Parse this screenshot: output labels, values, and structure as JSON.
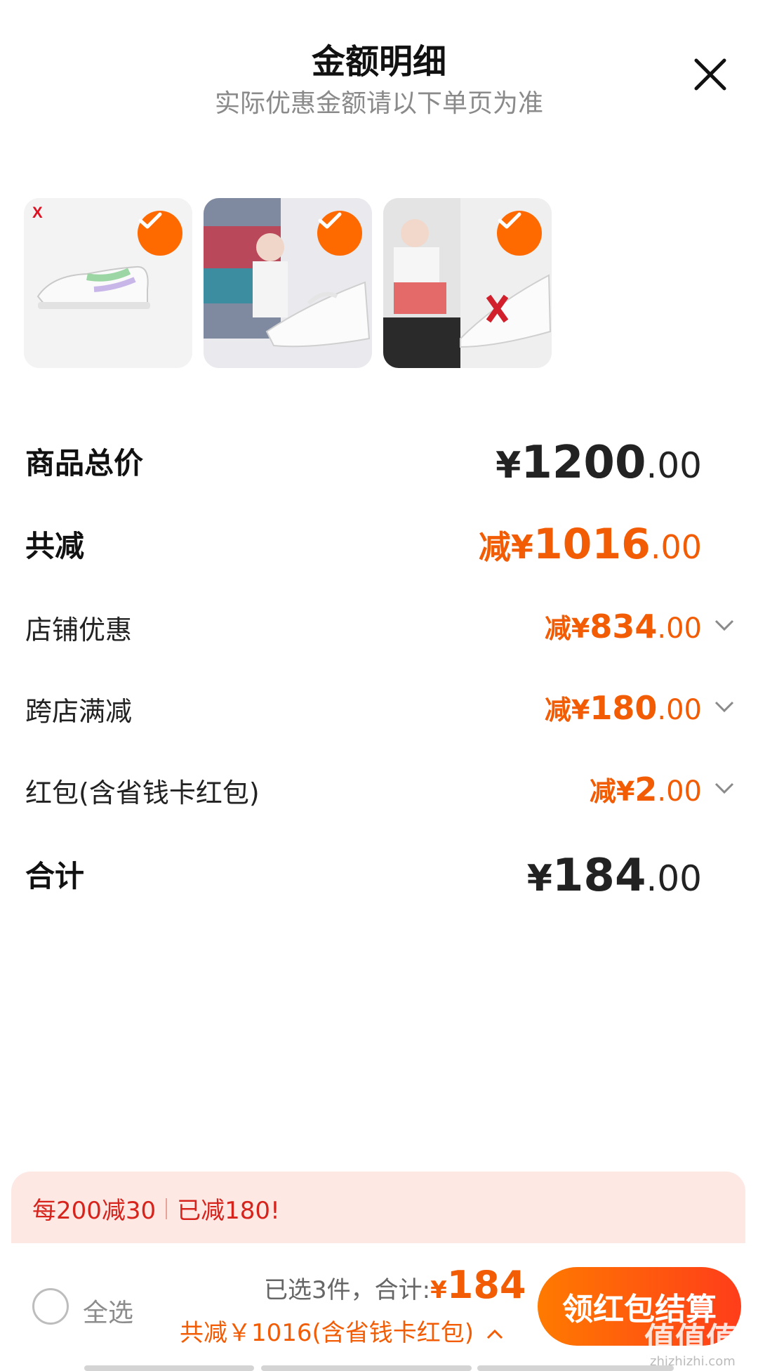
{
  "header": {
    "title": "金额明细",
    "subtitle": "实际优惠金额请以下单页为准"
  },
  "products": [
    {
      "name": "product-thumbnail-1",
      "checked": true
    },
    {
      "name": "product-thumbnail-2",
      "checked": true
    },
    {
      "name": "product-thumbnail-3",
      "checked": true
    }
  ],
  "breakdown": {
    "total": {
      "label": "商品总价",
      "symbol": "¥",
      "int": "1200",
      "dec": ".00"
    },
    "discount": {
      "label": "共减",
      "prefix": "减",
      "symbol": "¥",
      "int": "1016",
      "dec": ".00"
    },
    "shop": {
      "label": "店铺优惠",
      "prefix": "减",
      "symbol": "¥",
      "int": "834",
      "dec": ".00"
    },
    "cross": {
      "label": "跨店满减",
      "prefix": "减",
      "symbol": "¥",
      "int": "180",
      "dec": ".00"
    },
    "redpack": {
      "label": "红包(含省钱卡红包)",
      "prefix": "减",
      "symbol": "¥",
      "int": "2",
      "dec": ".00"
    },
    "sum": {
      "label": "合计",
      "symbol": "¥",
      "int": "184",
      "dec": ".00"
    }
  },
  "promo": {
    "rule": "每200减30",
    "status": "已减180!"
  },
  "footer": {
    "select_all": "全选",
    "selected_count": "已选3件，合计:",
    "total_symbol": "¥",
    "total_value": "184",
    "discount_note": "共减￥1016(含省钱卡红包)",
    "checkout_label": "领红包结算"
  },
  "watermark": {
    "brand": "值值值",
    "domain": "zhizhizhi.com"
  },
  "colors": {
    "accent": "#f25c05",
    "promo_bg": "#fde8e4",
    "promo_text": "#d6231c"
  }
}
